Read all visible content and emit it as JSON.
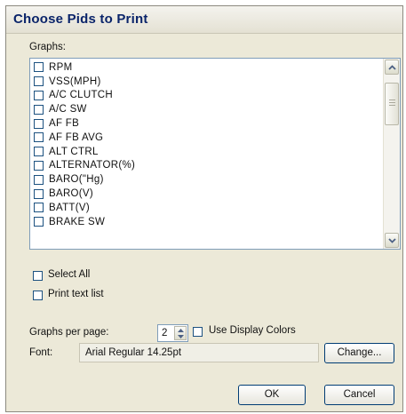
{
  "dialog": {
    "title": "Choose Pids to Print",
    "graphs_label": "Graphs:",
    "graph_items": [
      {
        "label": "RPM",
        "checked": false
      },
      {
        "label": "VSS(MPH)",
        "checked": false
      },
      {
        "label": "A/C CLUTCH",
        "checked": false
      },
      {
        "label": "A/C SW",
        "checked": false
      },
      {
        "label": "AF FB",
        "checked": false
      },
      {
        "label": "AF FB AVG",
        "checked": false
      },
      {
        "label": "ALT CTRL",
        "checked": false
      },
      {
        "label": "ALTERNATOR(%)",
        "checked": false
      },
      {
        "label": "BARO(\"Hg)",
        "checked": false
      },
      {
        "label": "BARO(V)",
        "checked": false
      },
      {
        "label": "BATT(V)",
        "checked": false
      },
      {
        "label": "BRAKE SW",
        "checked": false
      }
    ],
    "select_all": {
      "label": "Select All",
      "checked": false
    },
    "print_text_list": {
      "label": "Print text list",
      "checked": false
    },
    "graphs_per_page": {
      "label": "Graphs per page:",
      "value": "2"
    },
    "use_display_colors": {
      "label": "Use Display Colors",
      "checked": false
    },
    "font": {
      "label": "Font:",
      "value": "Arial Regular 14.25pt"
    },
    "buttons": {
      "change": "Change...",
      "ok": "OK",
      "cancel": "Cancel"
    },
    "icons": {
      "scroll_up": "chevron-up-icon",
      "scroll_down": "chevron-down-icon",
      "spin_up": "triangle-up-icon",
      "spin_down": "triangle-down-icon"
    }
  }
}
